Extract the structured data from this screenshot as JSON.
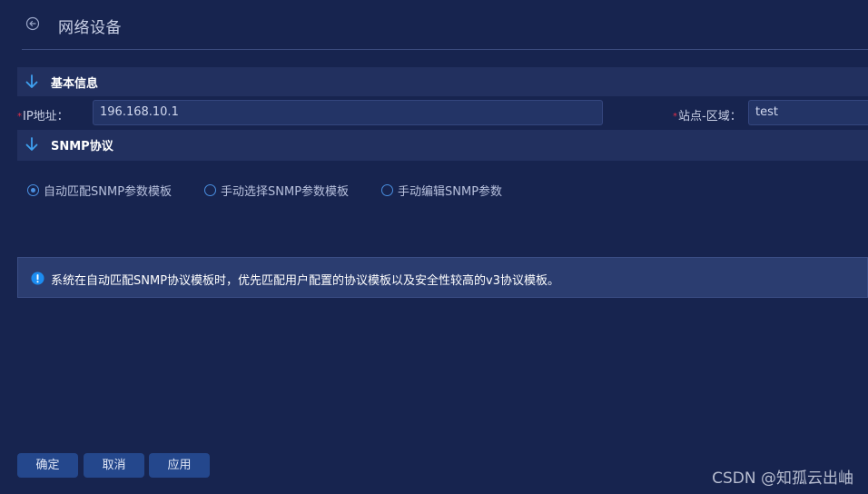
{
  "header": {
    "title": "网络设备",
    "back_icon": "circle-arrow-left-icon"
  },
  "sections": {
    "basic": {
      "label": "基本信息",
      "icon": "arrow-down-icon"
    },
    "snmp": {
      "label": "SNMP协议",
      "icon": "arrow-down-icon"
    }
  },
  "fields": {
    "ip": {
      "required_mark": "*",
      "label": "IP地址：",
      "value": "196.168.10.1"
    },
    "site": {
      "required_mark": "*",
      "label": "站点-区域：",
      "value": "test"
    }
  },
  "snmp_options": {
    "items": [
      {
        "label": "自动匹配SNMP参数模板",
        "checked": true
      },
      {
        "label": "手动选择SNMP参数模板",
        "checked": false
      },
      {
        "label": "手动编辑SNMP参数",
        "checked": false
      }
    ]
  },
  "info": {
    "icon": "info-circle-icon",
    "text": "系统在自动匹配SNMP协议模板时，优先匹配用户配置的协议模板以及安全性较高的v3协议模板。"
  },
  "buttons": {
    "confirm": "确定",
    "cancel": "取消",
    "apply": "应用"
  },
  "watermark": "CSDN @知孤云出岫",
  "colors": {
    "background": "#17244f",
    "section_bar": "#22305f",
    "accent": "#4a8fe0",
    "button": "#24478c",
    "required": "#e0304a"
  }
}
